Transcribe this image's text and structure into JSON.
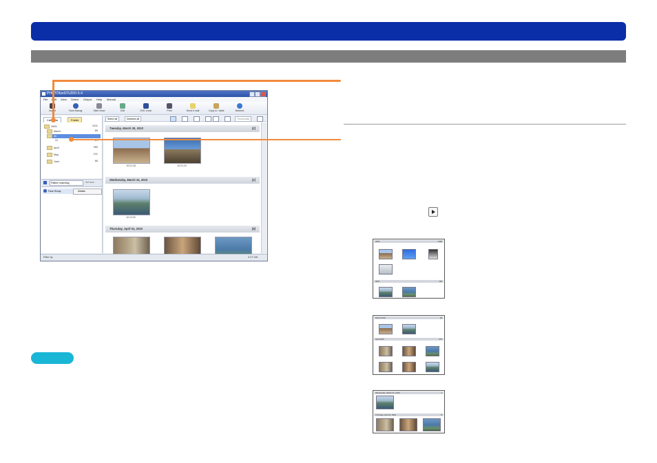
{
  "app": {
    "title": "PHOTOfunSTUDIO 6.4",
    "menus": [
      "File",
      "Edit",
      "View",
      "Select",
      "Output",
      "Help",
      "Manual"
    ],
    "toolbar": [
      "Import",
      "Face Manag.",
      "Slide show",
      "Edit",
      "DVD creat.",
      "Print",
      "Send e-mail",
      "Copy to / table",
      "Network"
    ],
    "tabs": {
      "calendar": "Calendar",
      "folder": "Folder"
    },
    "tree": [
      {
        "label": "2009",
        "count": "1011"
      },
      {
        "label": "March",
        "count": "89"
      },
      {
        "label": "30",
        "count": ""
      },
      {
        "label": "31",
        "count": "21"
      },
      {
        "label": "April",
        "count": "350"
      },
      {
        "label": "May",
        "count": "101"
      },
      {
        "label": "June",
        "count": "66"
      }
    ],
    "face_panel": {
      "field": "Pattern matching",
      "button": "Set face",
      "person": "Face Group",
      "person_btn": "Details"
    },
    "rp_buttons": {
      "b1": "Select all",
      "b2": "Deselect all",
      "display": "Thumbnails"
    },
    "groups": [
      {
        "date": "Tuesday, March 30, 2010",
        "count": "[2]",
        "labels": [
          "10:21:18",
          "10:21:23"
        ]
      },
      {
        "date": "Wednesday, March 31, 2010",
        "count": "[1]",
        "labels": [
          "10:12:32"
        ]
      },
      {
        "date": "Thursday, April 01, 2010",
        "count": "[8]",
        "labels": []
      }
    ],
    "status": {
      "left": "Filter by",
      "right": "0.27 GB"
    }
  },
  "mini1": {
    "head1": "2009",
    "count1": "1068",
    "head2": "2010",
    "count2": "125"
  },
  "mini2": {
    "head1": "March 2010",
    "count1": "29",
    "head2": "April 2010",
    "count2": "437"
  },
  "mini3": {
    "head1": "Wednesday, March 31, 2010",
    "count1": "1",
    "head2": "Thursday, April 01, 2010",
    "count2": "8"
  },
  "colors": {
    "header_bar": "#0a2ea8",
    "section_bar": "#7d7d7d",
    "callout": "#f28a3c",
    "note_badge": "#19b6d6"
  }
}
